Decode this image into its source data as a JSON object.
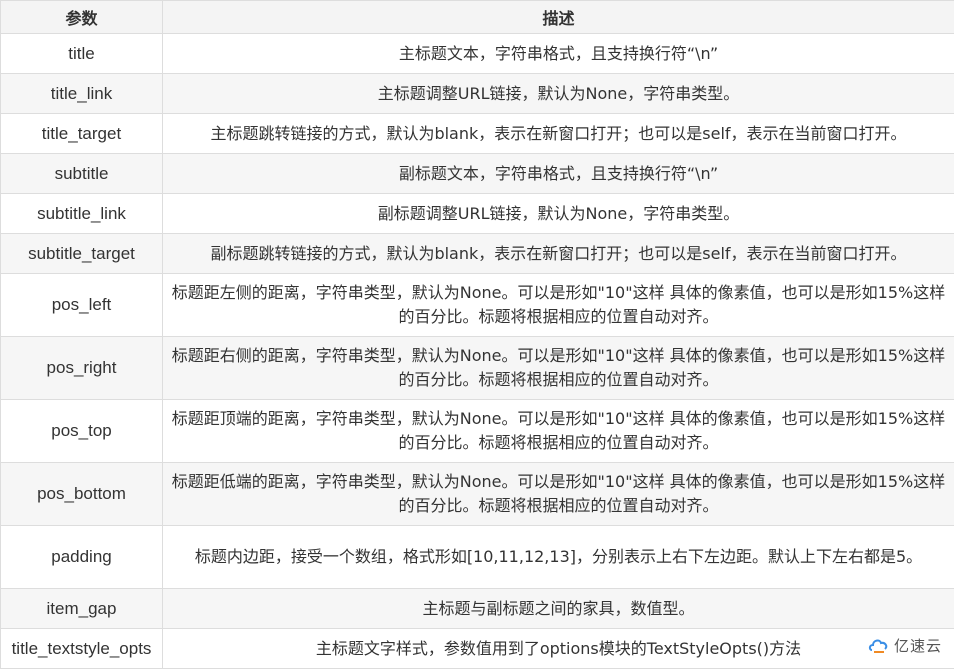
{
  "table": {
    "headers": [
      "参数",
      "描述"
    ],
    "rows": [
      {
        "name": "title",
        "desc": "主标题文本，字符串格式，且支持换行符“\\n”"
      },
      {
        "name": "title_link",
        "desc": "主标题调整URL链接，默认为None，字符串类型。"
      },
      {
        "name": "title_target",
        "desc": "主标题跳转链接的方式，默认为blank，表示在新窗口打开；也可以是self，表示在当前窗口打开。"
      },
      {
        "name": "subtitle",
        "desc": "副标题文本，字符串格式，且支持换行符“\\n”"
      },
      {
        "name": "subtitle_link",
        "desc": "副标题调整URL链接，默认为None，字符串类型。"
      },
      {
        "name": "subtitle_target",
        "desc": "副标题跳转链接的方式，默认为blank，表示在新窗口打开；也可以是self，表示在当前窗口打开。"
      },
      {
        "name": "pos_left",
        "desc": "标题距左侧的距离，字符串类型，默认为None。可以是形如\"10\"这样 具体的像素值，也可以是形如15%这样的百分比。标题将根据相应的位置自动对齐。"
      },
      {
        "name": "pos_right",
        "desc": "标题距右侧的距离，字符串类型，默认为None。可以是形如\"10\"这样 具体的像素值，也可以是形如15%这样的百分比。标题将根据相应的位置自动对齐。"
      },
      {
        "name": "pos_top",
        "desc": "标题距顶端的距离，字符串类型，默认为None。可以是形如\"10\"这样 具体的像素值，也可以是形如15%这样的百分比。标题将根据相应的位置自动对齐。"
      },
      {
        "name": "pos_bottom",
        "desc": "标题距低端的距离，字符串类型，默认为None。可以是形如\"10\"这样 具体的像素值，也可以是形如15%这样的百分比。标题将根据相应的位置自动对齐。"
      },
      {
        "name": "padding",
        "desc": "标题内边距，接受一个数组，格式形如[10,11,12,13]，分别表示上右下左边距。默认上下左右都是5。"
      },
      {
        "name": "item_gap",
        "desc": "主标题与副标题之间的家具，数值型。"
      },
      {
        "name": "title_textstyle_opts",
        "desc": "主标题文字样式，参数值用到了options模块的TextStyleOpts()方法"
      }
    ]
  },
  "watermark": {
    "text": "亿速云",
    "logo_icon": "yisu-cloud-logo-icon"
  }
}
